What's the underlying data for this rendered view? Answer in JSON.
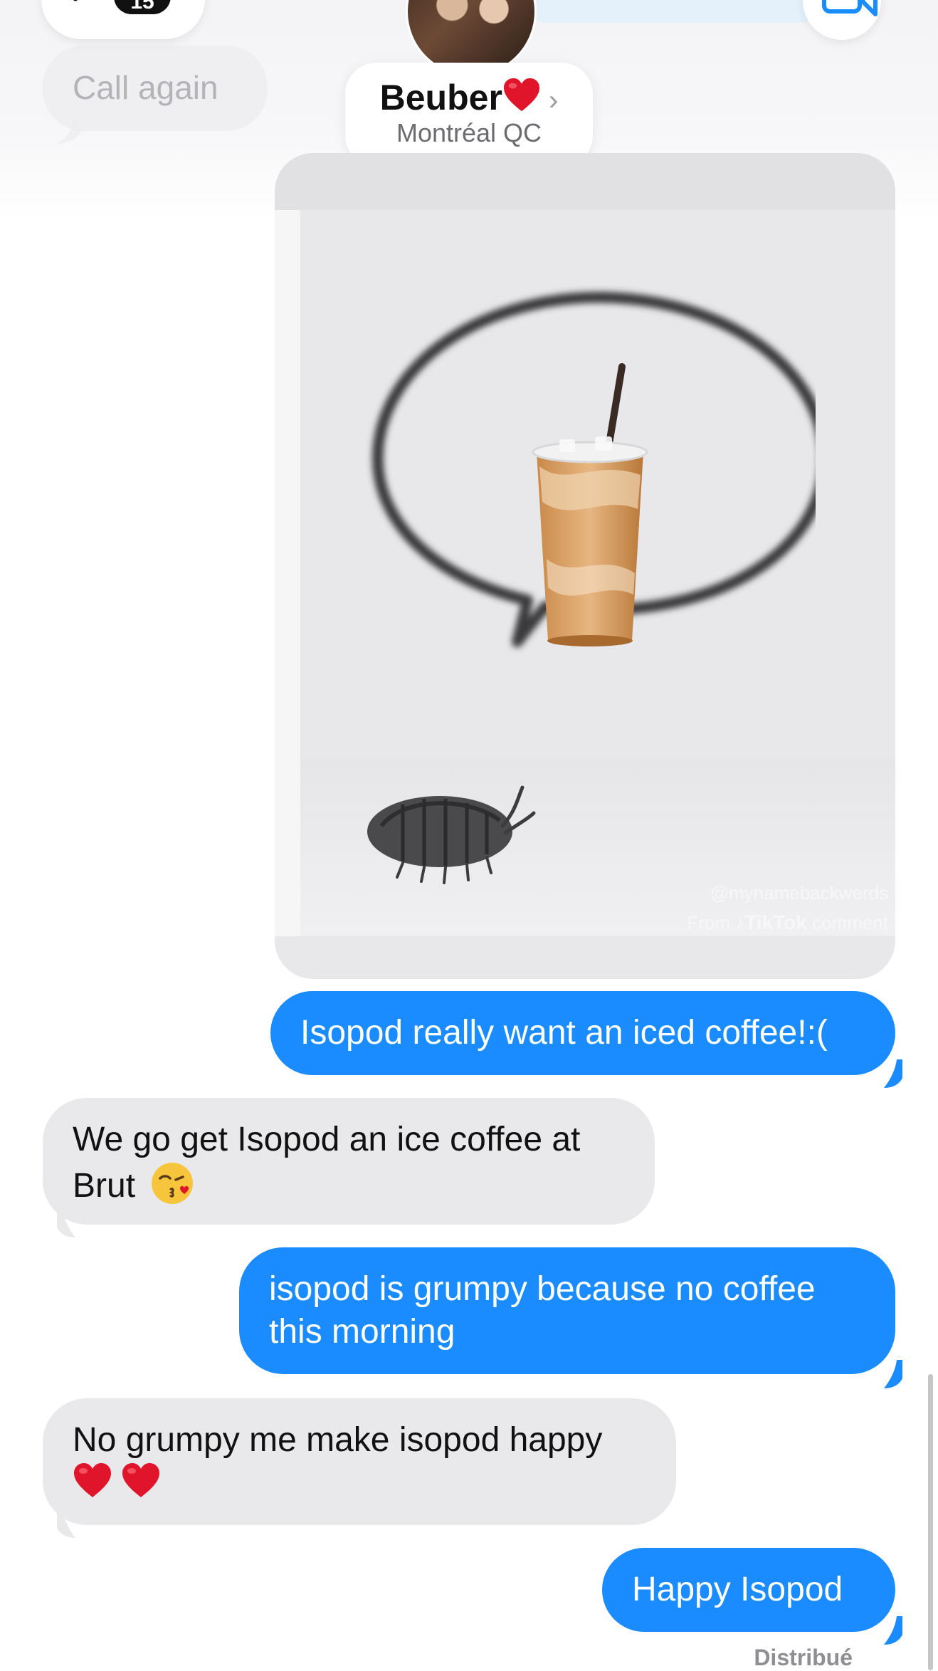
{
  "header": {
    "back_count": "15",
    "contact_name": "Beuber",
    "contact_location": "Montréal QC",
    "icons": [
      "chevron-left-icon",
      "video-camera-icon",
      "heart-emoji",
      "chevron-right-icon"
    ]
  },
  "previous_message": {
    "text": "Call again"
  },
  "attachment": {
    "watermark_handle": "@mynamebackwerds",
    "watermark_from": "From",
    "watermark_brand": "TikTok",
    "watermark_suffix": "comment"
  },
  "messages": [
    {
      "direction": "sent",
      "text": "Isopod really want an iced coffee!:("
    },
    {
      "direction": "received",
      "text": "We go get Isopod an ice coffee at Brut",
      "emoji": "kissing-heart-emoji"
    },
    {
      "direction": "sent",
      "text": "isopod is grumpy because no coffee this morning"
    },
    {
      "direction": "received",
      "text": "No grumpy me make isopod happy",
      "emoji": "two-red-hearts-emoji"
    },
    {
      "direction": "sent",
      "text": "Happy Isopod"
    }
  ],
  "delivery_status": "Distribué",
  "colors": {
    "sent_bubble": "#1a8cff",
    "received_bubble": "#e9e9eb",
    "heart": "#e0142a"
  }
}
